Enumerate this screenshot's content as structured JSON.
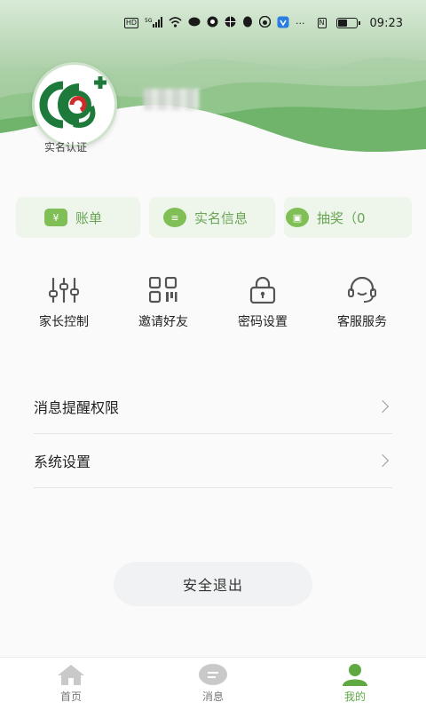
{
  "status_bar": {
    "time": "09:23",
    "hd": "HD",
    "network": "5G",
    "more": "···",
    "nfc": "N",
    "battery_level": 0.55
  },
  "profile": {
    "realname_label": "实名认证"
  },
  "quick_pills": [
    {
      "label": "账单",
      "icon": "wallet-icon",
      "icon_glyph": "¥"
    },
    {
      "label": "实名信息",
      "icon": "id-card-icon",
      "icon_glyph": "≡"
    },
    {
      "label": "抽奖（0",
      "icon": "gift-icon",
      "icon_glyph": "▣"
    }
  ],
  "grid_menu": [
    {
      "label": "家长控制",
      "icon": "sliders-icon"
    },
    {
      "label": "邀请好友",
      "icon": "qrcode-icon"
    },
    {
      "label": "密码设置",
      "icon": "lock-icon"
    },
    {
      "label": "客服服务",
      "icon": "headset-icon"
    }
  ],
  "settings_list": [
    {
      "label": "消息提醒权限"
    },
    {
      "label": "系统设置"
    }
  ],
  "logout_label": "安全退出",
  "tabbar": [
    {
      "label": "首页",
      "icon": "home-icon",
      "active": false
    },
    {
      "label": "消息",
      "icon": "message-icon",
      "active": false
    },
    {
      "label": "我的",
      "icon": "person-icon",
      "active": true
    }
  ],
  "colors": {
    "accent_green": "#5fa842",
    "header_green": "#74b66f",
    "icon_gray": "#555555"
  }
}
